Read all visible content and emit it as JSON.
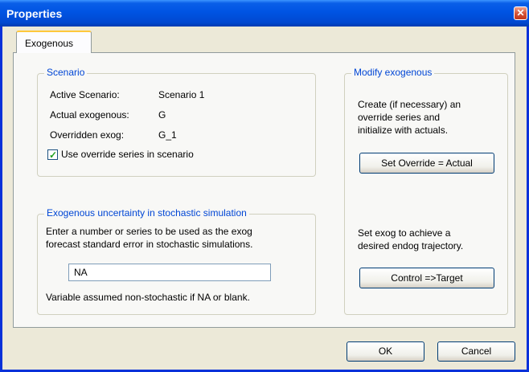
{
  "window": {
    "title": "Properties",
    "close_glyph": "✕"
  },
  "tabs": [
    {
      "label": "Exogenous"
    }
  ],
  "scenario": {
    "title": "Scenario",
    "rows": [
      {
        "label": "Active Scenario:",
        "value": "Scenario 1"
      },
      {
        "label": "Actual exogenous:",
        "value": "G"
      },
      {
        "label": "Overridden exog:",
        "value": "G_1"
      }
    ],
    "use_override": {
      "label": "Use override series in scenario",
      "checked": true
    }
  },
  "uncertainty": {
    "title": "Exogenous uncertainty in stochastic simulation",
    "desc_line1": "Enter a number or series to be used as the exog",
    "desc_line2": "forecast standard error in stochastic simulations.",
    "input_value": "NA",
    "note": "Variable assumed non-stochastic if NA or blank."
  },
  "modify": {
    "title": "Modify exogenous",
    "desc1_line1": "Create (if necessary) an",
    "desc1_line2": "override series and",
    "desc1_line3": "initialize with actuals.",
    "set_override_label": "Set Override = Actual",
    "desc2_line1": "Set exog to achieve a",
    "desc2_line2": "desired endog trajectory.",
    "control_label": "Control =>Target"
  },
  "footer": {
    "ok_label": "OK",
    "cancel_label": "Cancel"
  }
}
